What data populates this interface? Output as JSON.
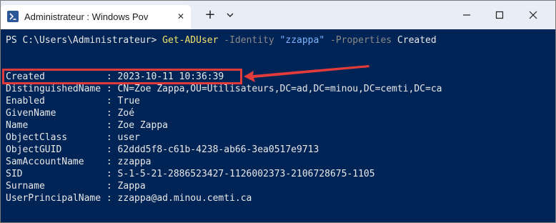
{
  "window": {
    "tab_title": "Administrateur : Windows Pov",
    "tab_close_glyph": "✕",
    "new_tab_glyph": "+",
    "icons": {
      "tab": "powershell-icon",
      "dropdown": "chevron-down-icon",
      "minimize": "minimize-icon",
      "maximize": "maximize-icon",
      "close": "close-icon"
    }
  },
  "console": {
    "prompt": "PS C:\\Users\\Administrateur> ",
    "command": "Get-ADUser",
    "param_identity": "-Identity",
    "identity_value": "\"zzappa\"",
    "param_properties": "-Properties",
    "properties_value": "Created",
    "rows": [
      {
        "key": "Created          ",
        "sep": " : ",
        "value": "2023-10-11 10:36:39"
      },
      {
        "key": "DistinguishedName",
        "sep": " : ",
        "value": "CN=Zoe Zappa,OU=Utilisateurs,DC=ad,DC=minou,DC=cemti,DC=ca"
      },
      {
        "key": "Enabled          ",
        "sep": " : ",
        "value": "True"
      },
      {
        "key": "GivenName        ",
        "sep": " : ",
        "value": "Zoé"
      },
      {
        "key": "Name             ",
        "sep": " : ",
        "value": "Zoe Zappa"
      },
      {
        "key": "ObjectClass      ",
        "sep": " : ",
        "value": "user"
      },
      {
        "key": "ObjectGUID       ",
        "sep": " : ",
        "value": "62ddd5f8-c61b-4238-ab66-3ea0517e9713"
      },
      {
        "key": "SamAccountName   ",
        "sep": " : ",
        "value": "zzappa"
      },
      {
        "key": "SID              ",
        "sep": " : ",
        "value": "S-1-5-21-2886523427-1126002373-2106728675-1105"
      },
      {
        "key": "Surname          ",
        "sep": " : ",
        "value": "Zappa"
      },
      {
        "key": "UserPrincipalName",
        "sep": " : ",
        "value": "zzappa@ad.minou.cemti.ca"
      }
    ]
  },
  "colors": {
    "console_bg": "#012456",
    "highlight": "#e23b3b",
    "command": "#f5e36b",
    "string": "#7fb3ff"
  }
}
